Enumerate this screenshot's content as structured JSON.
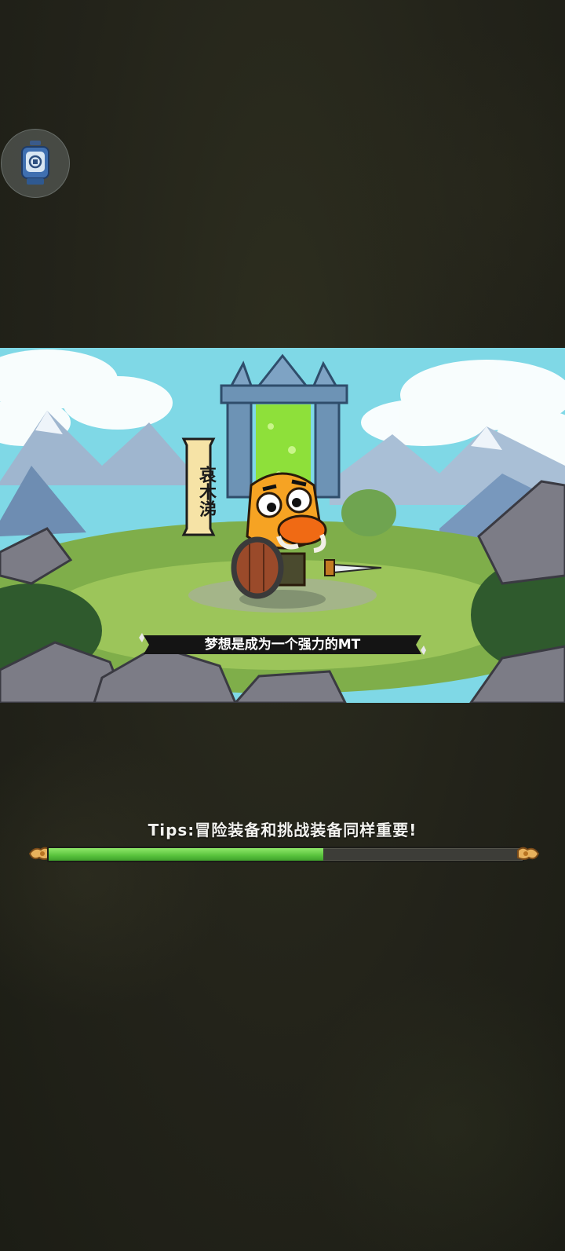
{
  "overlay": {
    "icon": "assistant-bot-icon"
  },
  "scene": {
    "character_name": "哀木涕",
    "speech": "梦想是成为一个强力的MT"
  },
  "loading": {
    "tips": "Tips:冒险装备和挑战装备同样重要!",
    "progress": 0.58
  },
  "colors": {
    "background": "#23231a",
    "progress_fill": "#58c23c",
    "progress_track": "#3d3d38",
    "sky": "#79d6e4"
  }
}
